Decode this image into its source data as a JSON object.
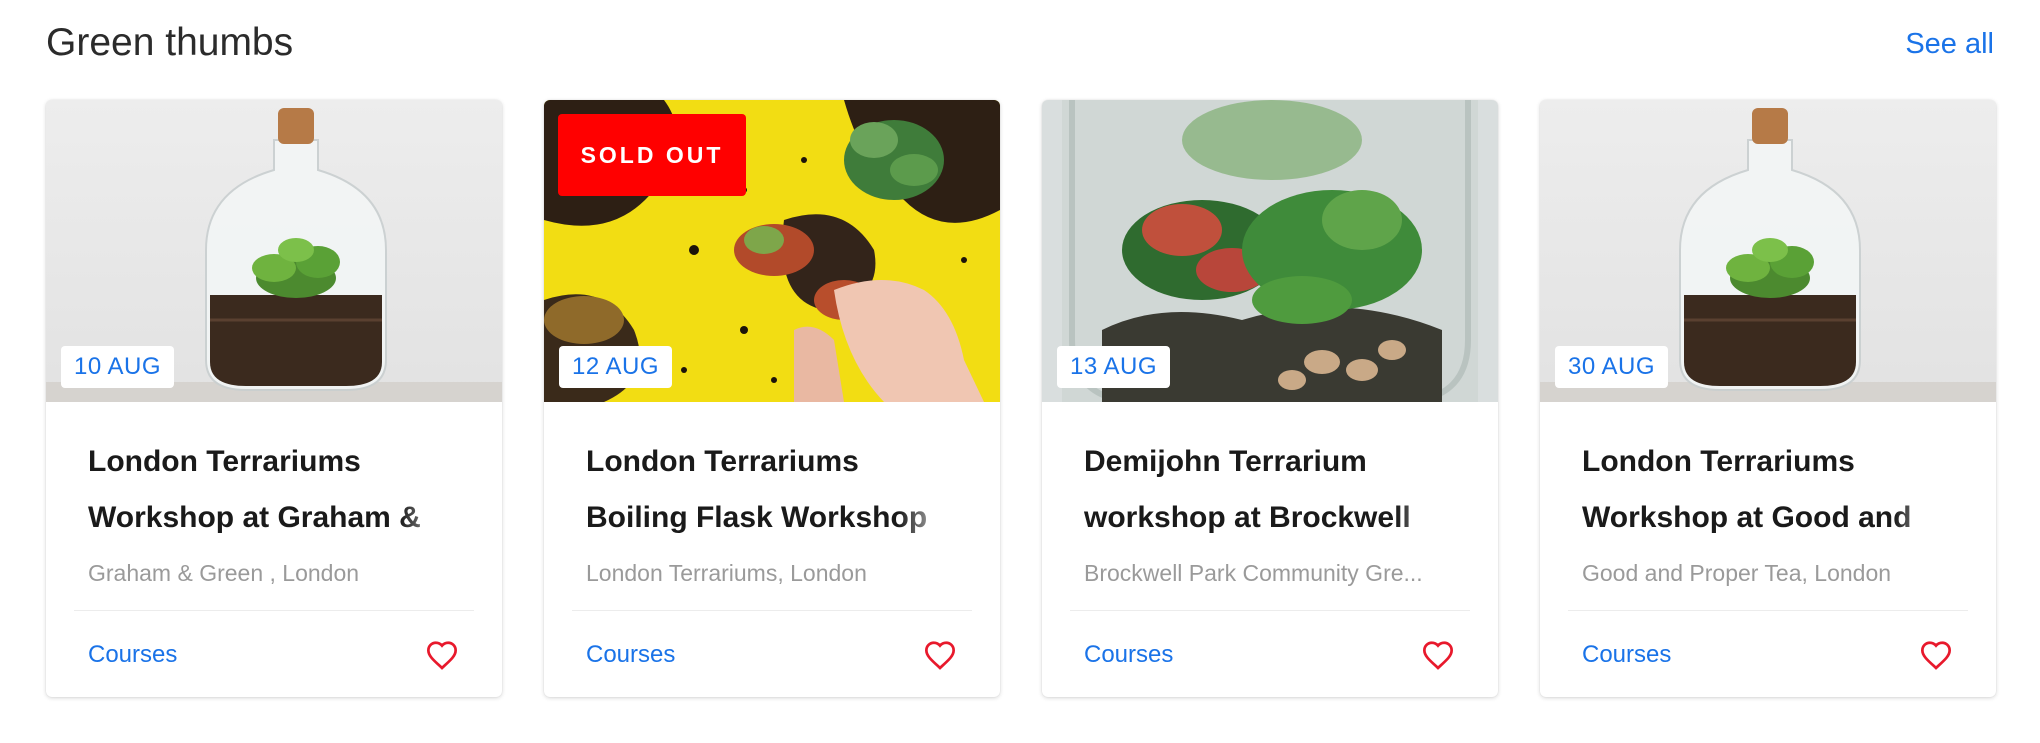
{
  "section": {
    "title": "Green thumbs",
    "see_all": "See all"
  },
  "colors": {
    "accent": "#1a73e8",
    "sold_out": "#ff0000",
    "heart": "#e8192c"
  },
  "cards": [
    {
      "date": "10 AUG",
      "title": "London Terrariums Workshop at Graham &",
      "location": "Graham & Green , London",
      "category": "Courses",
      "sold_out": false,
      "image": "glass-jar-terrarium-icon"
    },
    {
      "date": "12 AUG",
      "title": "London Terrariums Boiling Flask Workshop",
      "location": "London Terrariums, London",
      "category": "Courses",
      "sold_out": true,
      "sold_out_label": "SOLD OUT",
      "image": "plants-on-soil-icon"
    },
    {
      "date": "13 AUG",
      "title": "Demijohn Terrarium workshop at Brockwell",
      "location": "Brockwell Park Community Gre...",
      "category": "Courses",
      "sold_out": false,
      "image": "large-terrarium-icon"
    },
    {
      "date": "30 AUG",
      "title": "London Terrariums Workshop at Good and",
      "location": "Good and Proper Tea, London",
      "category": "Courses",
      "sold_out": false,
      "image": "glass-jar-terrarium-icon"
    }
  ]
}
